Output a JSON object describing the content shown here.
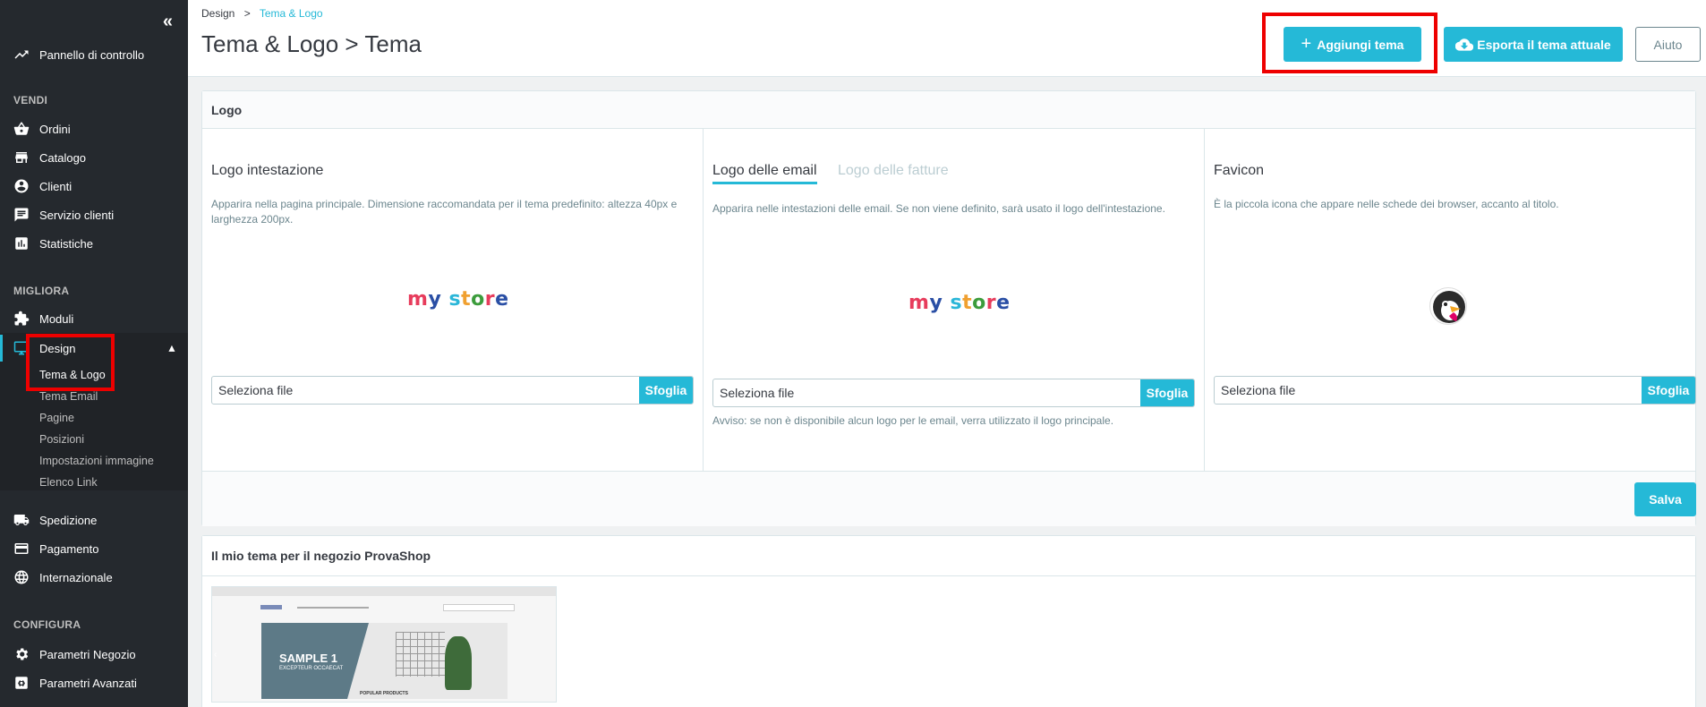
{
  "sidebar": {
    "collapse_glyph": "«",
    "dashboard": "Pannello di controllo",
    "sections": {
      "sell": "VENDI",
      "improve": "MIGLIORA",
      "configure": "CONFIGURA"
    },
    "sell_items": [
      "Ordini",
      "Catalogo",
      "Clienti",
      "Servizio clienti",
      "Statistiche"
    ],
    "improve_items": [
      "Moduli",
      "Design"
    ],
    "design_sub": [
      "Tema & Logo",
      "Tema Email",
      "Pagine",
      "Posizioni",
      "Impostazioni immagine",
      "Elenco Link"
    ],
    "after_design": [
      "Spedizione",
      "Pagamento",
      "Internazionale"
    ],
    "configure_items": [
      "Parametri Negozio",
      "Parametri Avanzati"
    ]
  },
  "header": {
    "breadcrumb_parent": "Design",
    "breadcrumb_sep": ">",
    "breadcrumb_current": "Tema & Logo",
    "title": "Tema & Logo > Tema",
    "add_theme": "Aggiungi tema",
    "export_theme": "Esporta il tema attuale",
    "help": "Aiuto"
  },
  "logo_card": {
    "header": "Logo",
    "header_logo": {
      "title": "Logo intestazione",
      "desc": "Apparira nella pagina principale. Dimensione raccomandata per il tema predefinito: altezza 40px e larghezza 200px.",
      "file_placeholder": "Seleziona file",
      "browse": "Sfoglia"
    },
    "email_logo": {
      "tab_active": "Logo delle email",
      "tab_inactive": "Logo delle fatture",
      "desc": "Apparira nelle intestazioni delle email. Se non viene definito, sarà usato il logo dell'intestazione.",
      "file_placeholder": "Seleziona file",
      "browse": "Sfoglia",
      "note": "Avviso: se non è disponibile alcun logo per le email, verra utilizzato il logo principale."
    },
    "favicon": {
      "title": "Favicon",
      "desc": "È la piccola icona che appare nelle schede dei browser, accanto al titolo.",
      "file_placeholder": "Seleziona file",
      "browse": "Sfoglia"
    },
    "logo_text": {
      "m": "m",
      "y": "y",
      "s": "s",
      "t": "t",
      "o": "o",
      "r": "r",
      "e": "e"
    },
    "save": "Salva"
  },
  "theme_card": {
    "header": "Il mio tema per il negozio ProvaShop",
    "preview": {
      "slide_title": "SAMPLE 1",
      "slide_sub": "EXCEPTEUR OCCAECAT",
      "popular": "POPULAR PRODUCTS"
    }
  },
  "colors": {
    "accent": "#25b9d7",
    "sidebar_bg": "#25292e",
    "highlight_box": "#e00000"
  }
}
